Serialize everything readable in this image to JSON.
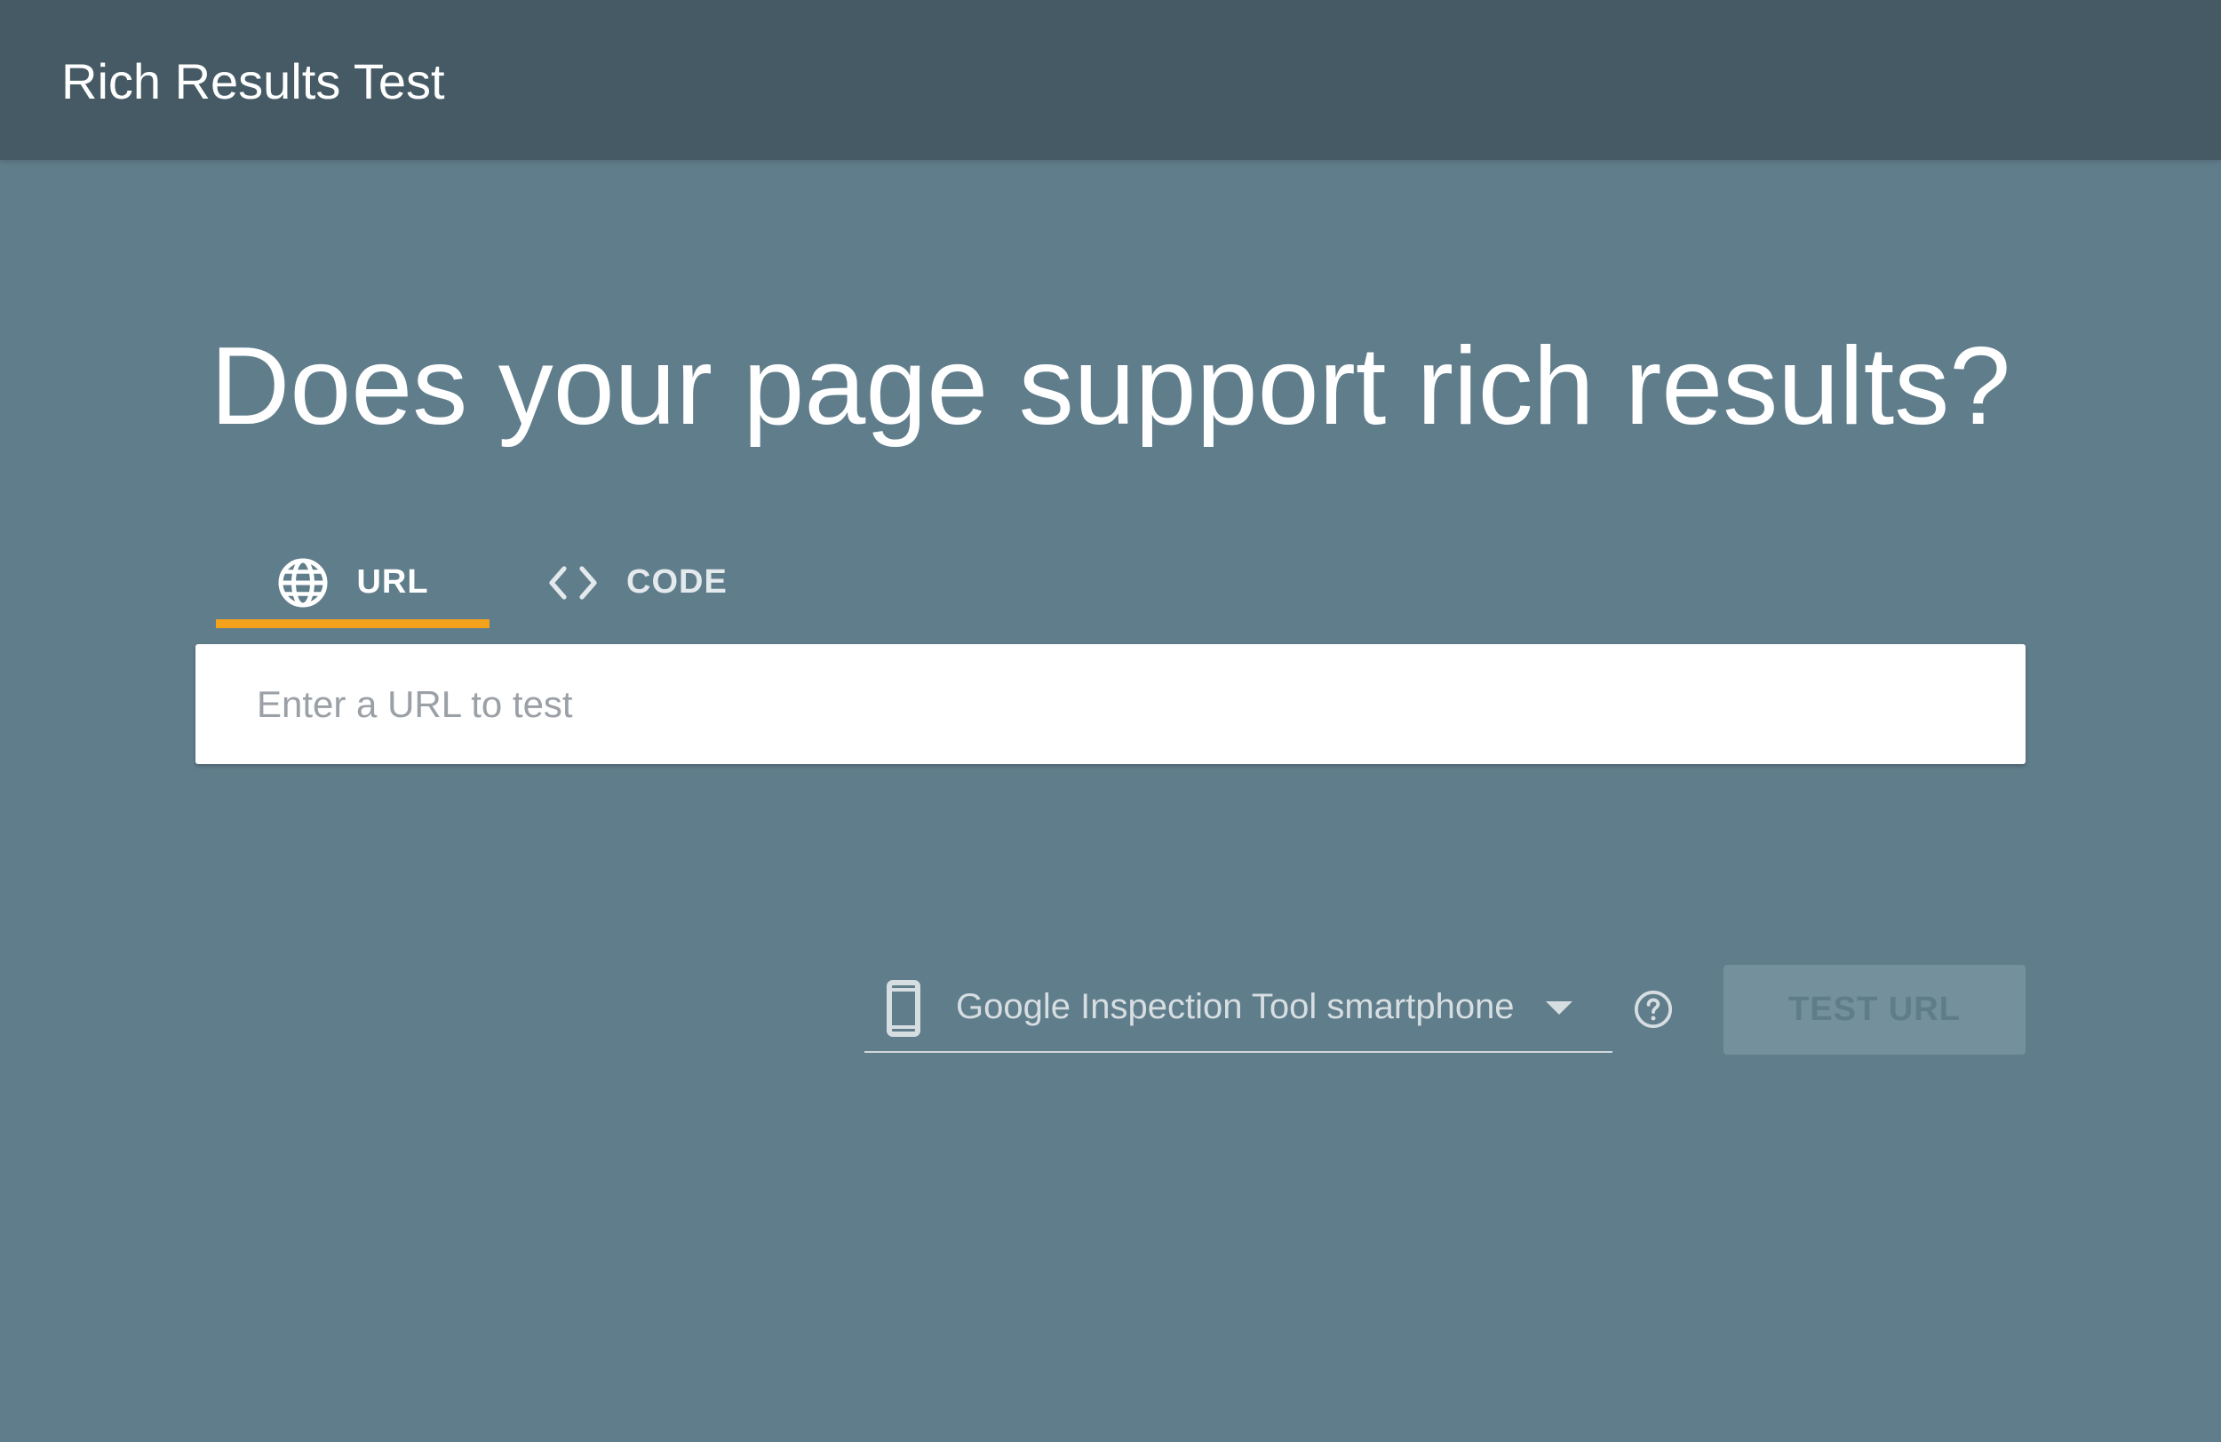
{
  "app": {
    "title": "Rich Results Test"
  },
  "main": {
    "headline": "Does your page support rich results?",
    "tabs": [
      {
        "label": "URL",
        "icon": "globe-icon",
        "selected": true
      },
      {
        "label": "CODE",
        "icon": "code-icon",
        "selected": false
      }
    ],
    "url_input": {
      "value": "",
      "placeholder": "Enter a URL to test"
    },
    "user_agent": {
      "icon": "smartphone-icon",
      "selected": "Google Inspection Tool smartphone"
    },
    "test_button": {
      "label": "TEST URL",
      "enabled": false
    }
  },
  "colors": {
    "app_bar": "#455a64",
    "background": "#607d8b",
    "tab_indicator": "#f4a11b",
    "disabled_button": "#73909c"
  }
}
